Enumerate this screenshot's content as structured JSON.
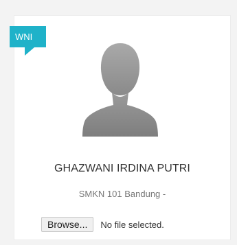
{
  "badge": {
    "label": "WNI",
    "color": "#1fb2c9"
  },
  "profile": {
    "avatar_icon": "default-user-silhouette-icon",
    "name": "GHAZWANI IRDINA PUTRI",
    "school": "SMKN 101 Bandung -"
  },
  "file_input": {
    "button_label": "Browse...",
    "status": "No file selected."
  }
}
